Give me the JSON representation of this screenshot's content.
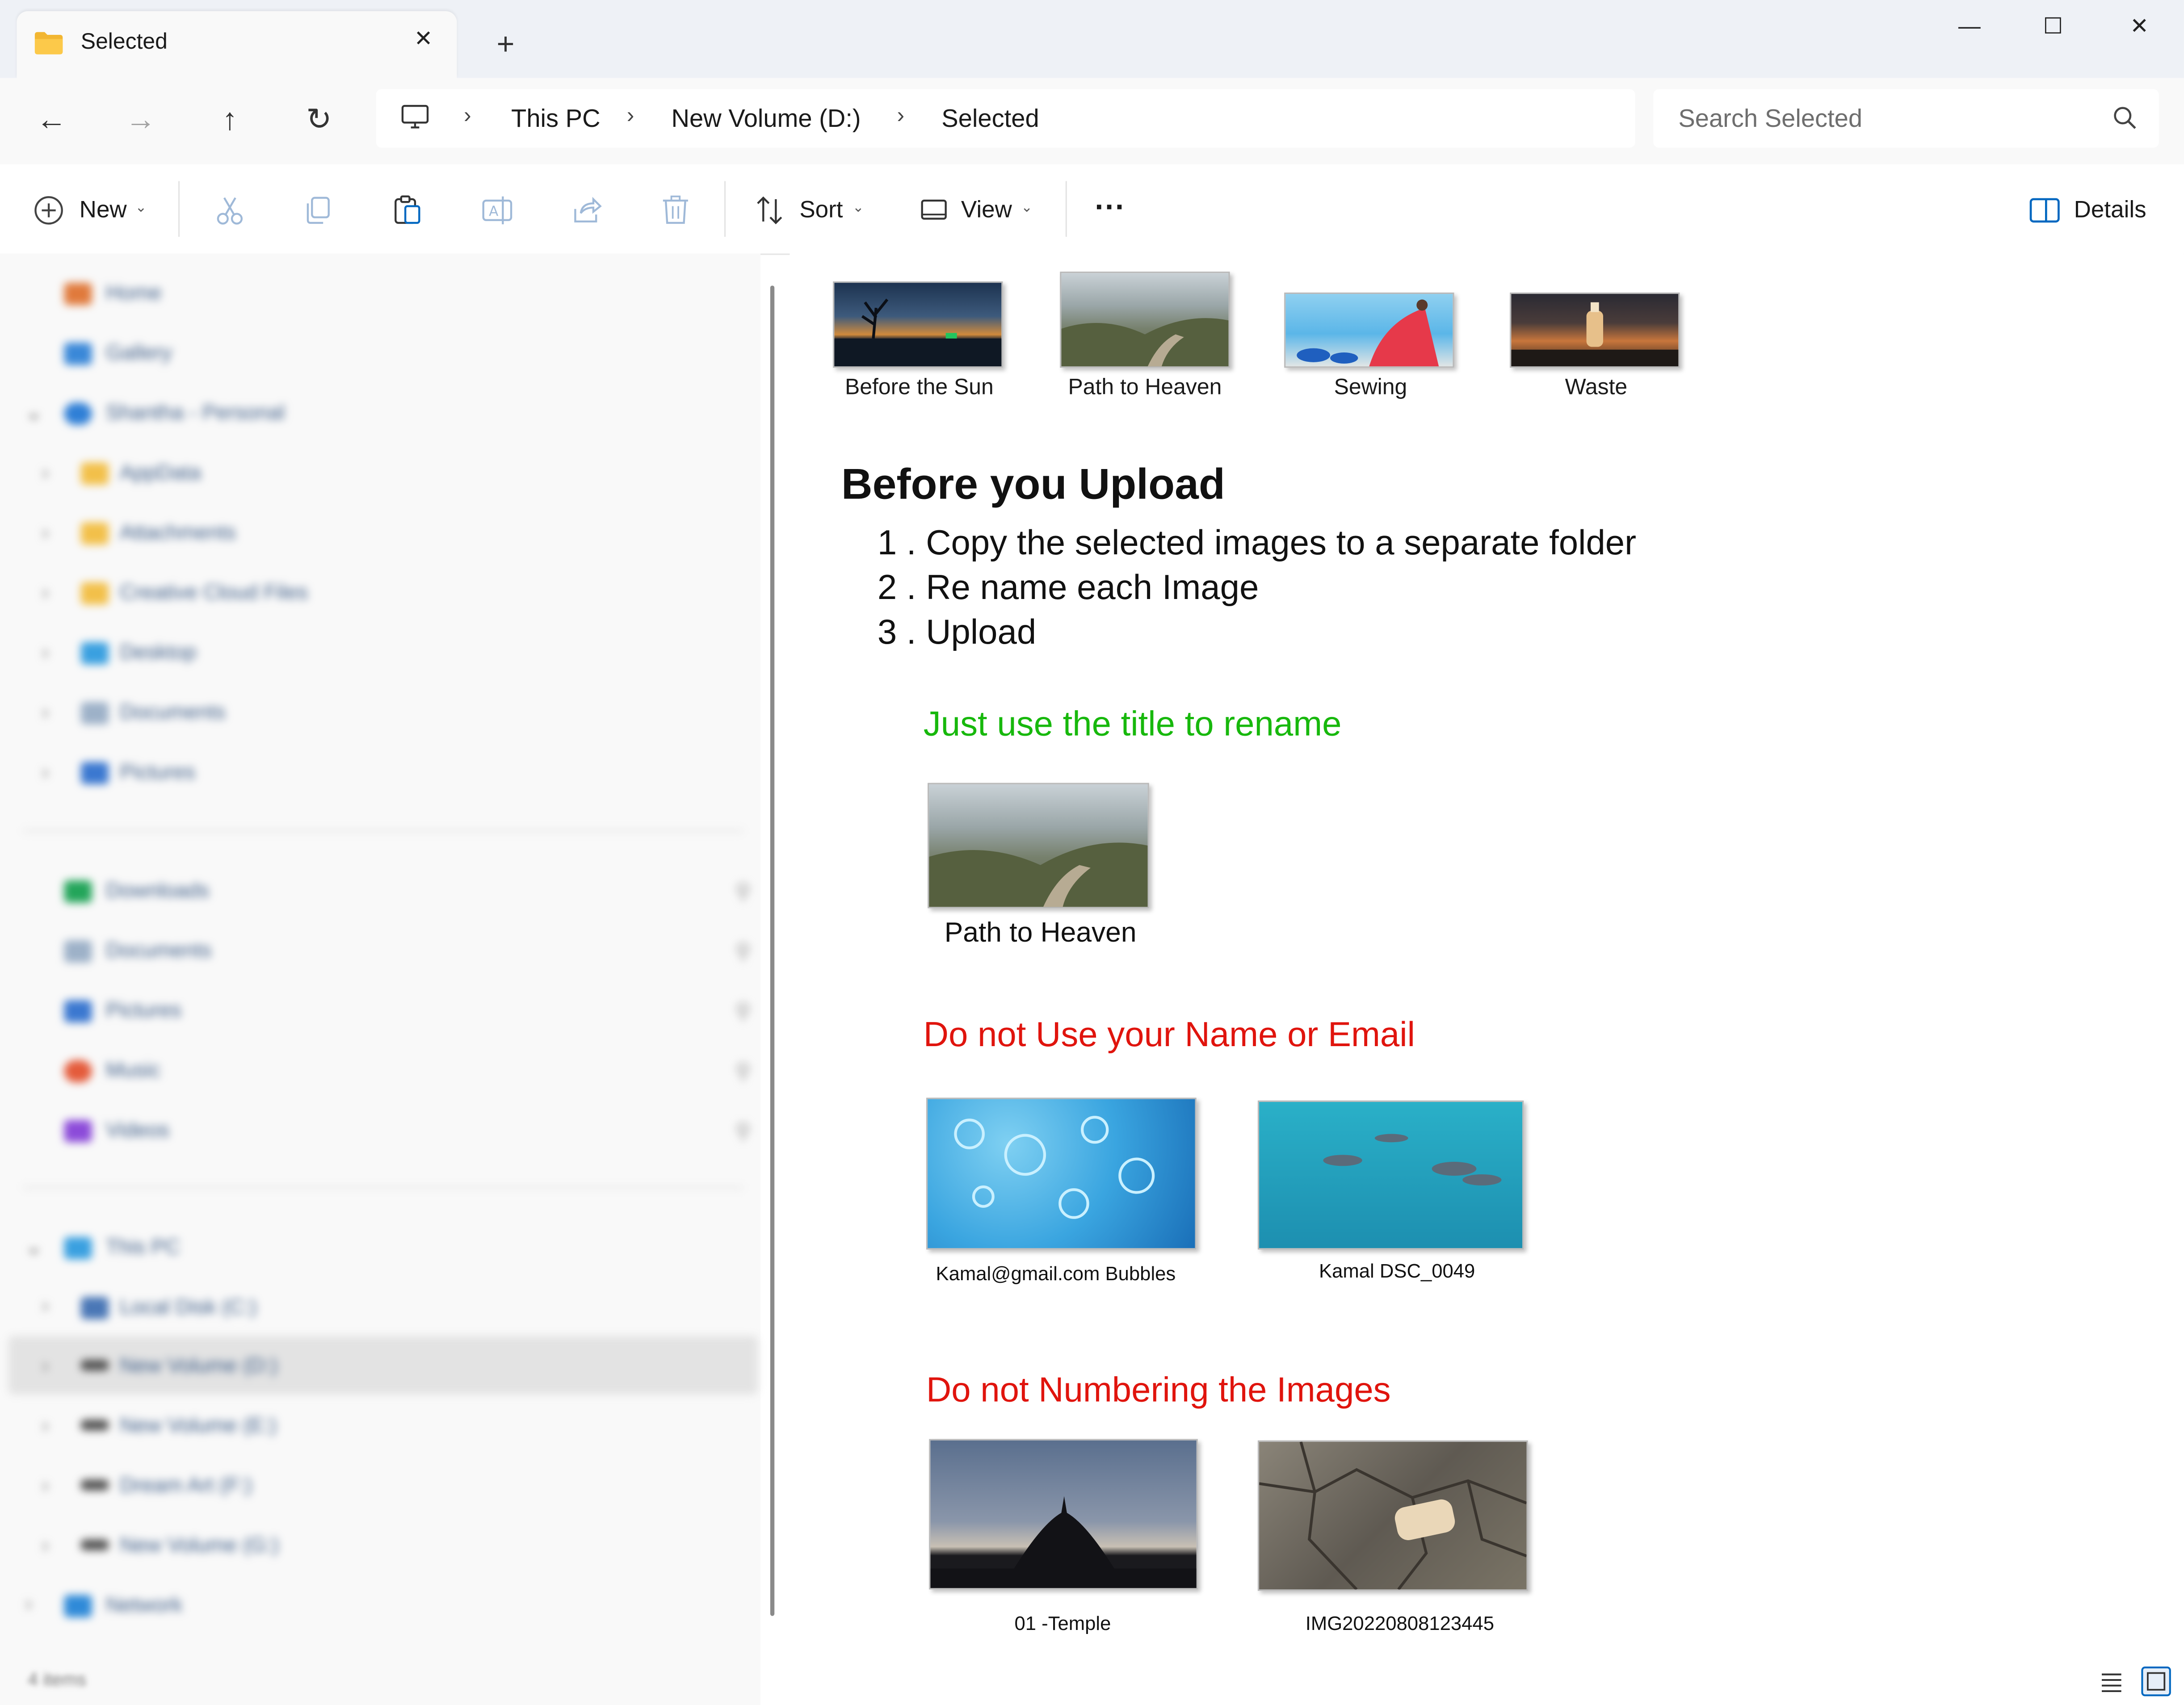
{
  "window": {
    "tab_title": "Selected",
    "new_tab": "+",
    "minimize": "—",
    "maximize": "☐",
    "close": "✕"
  },
  "breadcrumb": {
    "items": [
      "This PC",
      "New Volume (D:)",
      "Selected"
    ]
  },
  "search": {
    "placeholder": "Search Selected"
  },
  "toolbar": {
    "new_label": "New",
    "sort_label": "Sort",
    "view_label": "View",
    "more_label": "···",
    "details_label": "Details"
  },
  "sidebar": {
    "quick": [
      "Home",
      "Gallery"
    ],
    "cloud": {
      "label": "Shantha - Personal",
      "children": [
        "AppData",
        "Attachments",
        "Creative Cloud Files",
        "Desktop",
        "Documents",
        "Pictures"
      ]
    },
    "pinned": [
      "Downloads",
      "Documents",
      "Pictures",
      "Music",
      "Videos"
    ],
    "thispc": {
      "label": "This PC",
      "drives": [
        "Local Disk (C:)",
        "New Volume (D:)",
        "New Volume (E:)",
        "Dream Art (F:)",
        "New Volume (G:)"
      ]
    },
    "network": "Network"
  },
  "files": [
    {
      "name": "Before the Sun"
    },
    {
      "name": "Path to Heaven"
    },
    {
      "name": "Sewing"
    },
    {
      "name": "Waste"
    }
  ],
  "preview": {
    "heading": "Before you Upload",
    "steps": [
      "1 . Copy the selected images to a separate folder",
      "2 . Re name each Image",
      "3 . Upload"
    ],
    "tip_good": "Just use the title to rename",
    "good_example": "Path to Heaven",
    "tip_bad_name": "Do not Use your Name or Email",
    "bad_name_examples": [
      "Kamal@gmail.com Bubbles",
      "Kamal DSC_0049"
    ],
    "tip_bad_number": "Do not Numbering the Images",
    "bad_number_examples": [
      "01 -Temple",
      "IMG20220808123445"
    ]
  },
  "status": {
    "item_count": "4 items"
  },
  "colors": {
    "accent": "#0067c0",
    "good_text": "#17b80c",
    "bad_text": "#e0140d"
  }
}
